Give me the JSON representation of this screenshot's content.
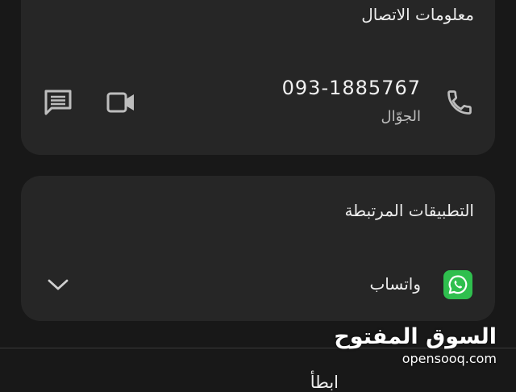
{
  "contact_card": {
    "title": "معلومات الاتصال",
    "phone_number": "093-1885767",
    "phone_type": "الجوّال",
    "icons": [
      "phone-icon",
      "video-call-icon",
      "message-icon"
    ]
  },
  "apps_card": {
    "title": "التطبيقات المرتبطة",
    "apps": [
      {
        "name": "واتساب",
        "icon": "whatsapp-icon"
      }
    ],
    "expand_icon": "chevron-down-icon"
  },
  "next_section": {
    "heading": "ابطأ"
  },
  "watermark": {
    "arabic": "السوق المفتوح",
    "latin": "opensooq.com"
  },
  "colors": {
    "background": "#181818",
    "card": "#262626",
    "whatsapp": "#2fbf4e",
    "text": "#ededed",
    "secondary_text": "#bdbdbd"
  }
}
